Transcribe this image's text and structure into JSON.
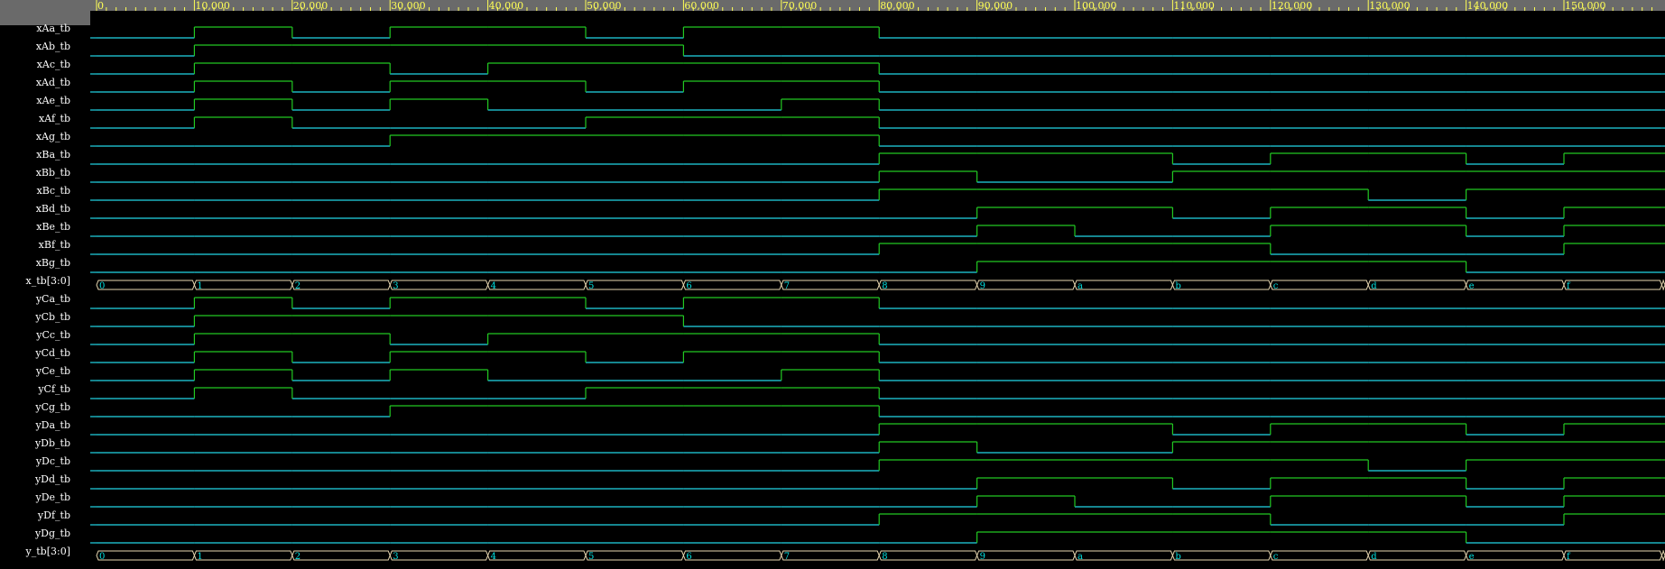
{
  "ruler": {
    "ticks": [
      "0",
      "10,000",
      "20,000",
      "30,000",
      "40,000",
      "50,000",
      "60,000",
      "70,000",
      "80,000",
      "90,000",
      "100,000",
      "110,000",
      "120,000",
      "130,000",
      "140,000",
      "150,000"
    ]
  },
  "signals": [
    {
      "name": "xAa_tb",
      "type": "bit",
      "values": [
        0,
        1,
        0,
        1,
        1,
        0,
        1,
        1,
        0,
        0,
        0,
        0,
        0,
        0,
        0,
        0,
        0
      ]
    },
    {
      "name": "xAb_tb",
      "type": "bit",
      "values": [
        0,
        1,
        1,
        1,
        1,
        1,
        0,
        0,
        0,
        0,
        0,
        0,
        0,
        0,
        0,
        0,
        0
      ]
    },
    {
      "name": "xAc_tb",
      "type": "bit",
      "values": [
        0,
        1,
        1,
        0,
        1,
        1,
        1,
        1,
        0,
        0,
        0,
        0,
        0,
        0,
        0,
        0,
        0
      ]
    },
    {
      "name": "xAd_tb",
      "type": "bit",
      "values": [
        0,
        1,
        0,
        1,
        1,
        0,
        1,
        1,
        0,
        0,
        0,
        0,
        0,
        0,
        0,
        0,
        0
      ]
    },
    {
      "name": "xAe_tb",
      "type": "bit",
      "values": [
        0,
        1,
        0,
        1,
        0,
        0,
        0,
        1,
        0,
        0,
        0,
        0,
        0,
        0,
        0,
        0,
        0
      ]
    },
    {
      "name": "xAf_tb",
      "type": "bit",
      "values": [
        0,
        1,
        0,
        0,
        0,
        1,
        1,
        1,
        0,
        0,
        0,
        0,
        0,
        0,
        0,
        0,
        0
      ]
    },
    {
      "name": "xAg_tb",
      "type": "bit",
      "values": [
        0,
        0,
        0,
        1,
        1,
        1,
        1,
        1,
        0,
        0,
        0,
        0,
        0,
        0,
        0,
        0,
        0
      ]
    },
    {
      "name": "xBa_tb",
      "type": "bit",
      "values": [
        0,
        0,
        0,
        0,
        0,
        0,
        0,
        0,
        1,
        1,
        1,
        0,
        1,
        1,
        0,
        1,
        1
      ]
    },
    {
      "name": "xBb_tb",
      "type": "bit",
      "values": [
        0,
        0,
        0,
        0,
        0,
        0,
        0,
        0,
        1,
        0,
        0,
        1,
        1,
        1,
        1,
        1,
        1
      ]
    },
    {
      "name": "xBc_tb",
      "type": "bit",
      "values": [
        0,
        0,
        0,
        0,
        0,
        0,
        0,
        0,
        1,
        1,
        1,
        1,
        1,
        0,
        1,
        1,
        1
      ]
    },
    {
      "name": "xBd_tb",
      "type": "bit",
      "values": [
        0,
        0,
        0,
        0,
        0,
        0,
        0,
        0,
        0,
        1,
        1,
        0,
        1,
        1,
        0,
        1,
        1
      ]
    },
    {
      "name": "xBe_tb",
      "type": "bit",
      "values": [
        0,
        0,
        0,
        0,
        0,
        0,
        0,
        0,
        0,
        1,
        0,
        0,
        1,
        1,
        0,
        1,
        1
      ]
    },
    {
      "name": "xBf_tb",
      "type": "bit",
      "values": [
        0,
        0,
        0,
        0,
        0,
        0,
        0,
        0,
        1,
        1,
        1,
        1,
        0,
        0,
        0,
        1,
        1
      ]
    },
    {
      "name": "xBg_tb",
      "type": "bit",
      "values": [
        0,
        0,
        0,
        0,
        0,
        0,
        0,
        0,
        0,
        1,
        1,
        1,
        1,
        1,
        0,
        0,
        0
      ]
    },
    {
      "name": "x_tb[3:0]",
      "type": "bus",
      "values": [
        "0",
        "1",
        "2",
        "3",
        "4",
        "5",
        "6",
        "7",
        "8",
        "9",
        "a",
        "b",
        "c",
        "d",
        "e",
        "f",
        ""
      ]
    },
    {
      "name": "yCa_tb",
      "type": "bit",
      "values": [
        0,
        1,
        0,
        1,
        1,
        0,
        1,
        1,
        0,
        0,
        0,
        0,
        0,
        0,
        0,
        0,
        0
      ]
    },
    {
      "name": "yCb_tb",
      "type": "bit",
      "values": [
        0,
        1,
        1,
        1,
        1,
        1,
        0,
        0,
        0,
        0,
        0,
        0,
        0,
        0,
        0,
        0,
        0
      ]
    },
    {
      "name": "yCc_tb",
      "type": "bit",
      "values": [
        0,
        1,
        1,
        0,
        1,
        1,
        1,
        1,
        0,
        0,
        0,
        0,
        0,
        0,
        0,
        0,
        0
      ]
    },
    {
      "name": "yCd_tb",
      "type": "bit",
      "values": [
        0,
        1,
        0,
        1,
        1,
        0,
        1,
        1,
        0,
        0,
        0,
        0,
        0,
        0,
        0,
        0,
        0
      ]
    },
    {
      "name": "yCe_tb",
      "type": "bit",
      "values": [
        0,
        1,
        0,
        1,
        0,
        0,
        0,
        1,
        0,
        0,
        0,
        0,
        0,
        0,
        0,
        0,
        0
      ]
    },
    {
      "name": "yCf_tb",
      "type": "bit",
      "values": [
        0,
        1,
        0,
        0,
        0,
        1,
        1,
        1,
        0,
        0,
        0,
        0,
        0,
        0,
        0,
        0,
        0
      ]
    },
    {
      "name": "yCg_tb",
      "type": "bit",
      "values": [
        0,
        0,
        0,
        1,
        1,
        1,
        1,
        1,
        0,
        0,
        0,
        0,
        0,
        0,
        0,
        0,
        0
      ]
    },
    {
      "name": "yDa_tb",
      "type": "bit",
      "values": [
        0,
        0,
        0,
        0,
        0,
        0,
        0,
        0,
        1,
        1,
        1,
        0,
        1,
        1,
        0,
        1,
        1
      ]
    },
    {
      "name": "yDb_tb",
      "type": "bit",
      "values": [
        0,
        0,
        0,
        0,
        0,
        0,
        0,
        0,
        1,
        0,
        0,
        1,
        1,
        1,
        1,
        1,
        1
      ]
    },
    {
      "name": "yDc_tb",
      "type": "bit",
      "values": [
        0,
        0,
        0,
        0,
        0,
        0,
        0,
        0,
        1,
        1,
        1,
        1,
        1,
        0,
        1,
        1,
        1
      ]
    },
    {
      "name": "yDd_tb",
      "type": "bit",
      "values": [
        0,
        0,
        0,
        0,
        0,
        0,
        0,
        0,
        0,
        1,
        1,
        0,
        1,
        1,
        0,
        1,
        1
      ]
    },
    {
      "name": "yDe_tb",
      "type": "bit",
      "values": [
        0,
        0,
        0,
        0,
        0,
        0,
        0,
        0,
        0,
        1,
        0,
        0,
        1,
        1,
        0,
        1,
        1
      ]
    },
    {
      "name": "yDf_tb",
      "type": "bit",
      "values": [
        0,
        0,
        0,
        0,
        0,
        0,
        0,
        0,
        1,
        1,
        1,
        1,
        0,
        0,
        0,
        1,
        1
      ]
    },
    {
      "name": "yDg_tb",
      "type": "bit",
      "values": [
        0,
        0,
        0,
        0,
        0,
        0,
        0,
        0,
        0,
        1,
        1,
        1,
        1,
        1,
        0,
        0,
        0
      ]
    },
    {
      "name": "y_tb[3:0]",
      "type": "bus",
      "values": [
        "0",
        "1",
        "2",
        "3",
        "4",
        "5",
        "6",
        "7",
        "8",
        "9",
        "a",
        "b",
        "c",
        "d",
        "e",
        "f",
        ""
      ]
    }
  ],
  "colors": {
    "ruler_bg": "#6a6a6a",
    "ruler_text": "#ffff55",
    "low": "#22d6e6",
    "high": "#22c822",
    "bus": "#e8d8b0",
    "bus_text": "#00e0e0",
    "name_text": "#ffffff"
  }
}
